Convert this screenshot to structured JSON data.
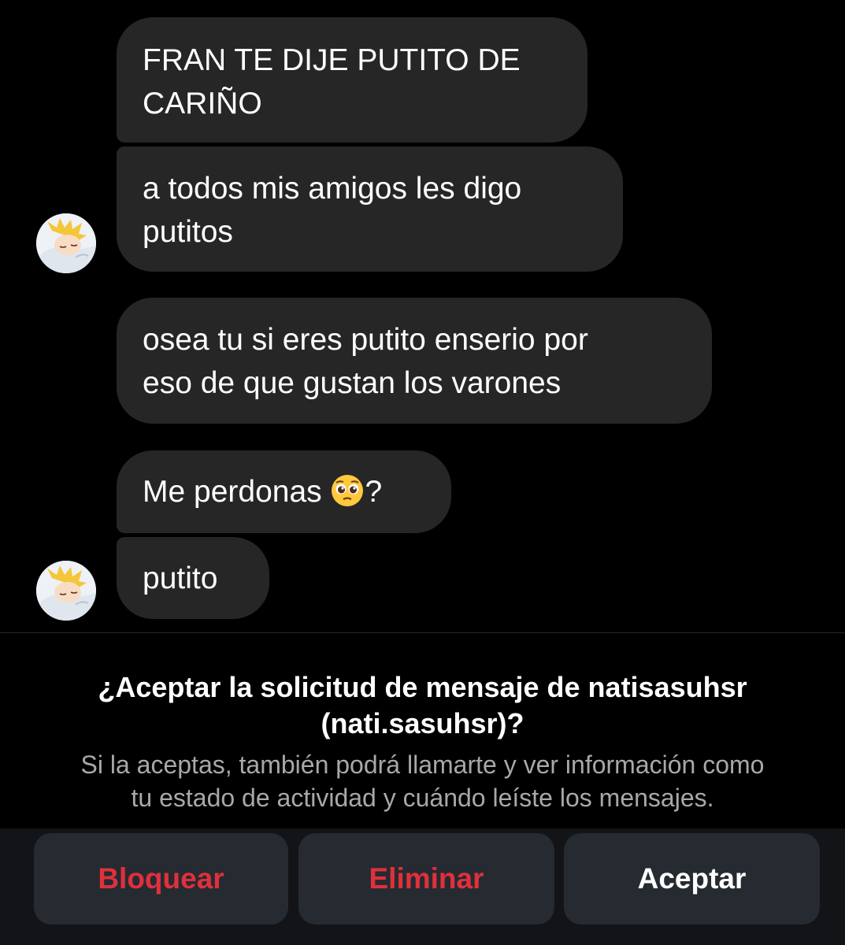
{
  "messages": [
    {
      "lines": [
        "FRAN TE DIJE PUTITO DE",
        "CARIÑO"
      ]
    },
    {
      "lines": [
        "a todos mis amigos les digo",
        "putitos"
      ]
    },
    {
      "lines": [
        "osea tu si eres putito enserio por",
        "eso de que gustan los varones"
      ]
    },
    {
      "text_before_emoji": "Me perdonas ",
      "emoji": "pleading-face",
      "text_after_emoji": "?"
    },
    {
      "lines": [
        "putito"
      ]
    }
  ],
  "request": {
    "title_line1": "¿Aceptar la solicitud de mensaje de natisasuhsr",
    "title_line2": "(nati.sasuhsr)?",
    "desc_line1": "Si la aceptas, también podrá llamarte y ver información como",
    "desc_line2": "tu estado de actividad y cuándo leíste los mensajes."
  },
  "actions": {
    "block_label": "Bloquear",
    "delete_label": "Eliminar",
    "accept_label": "Aceptar"
  },
  "colors": {
    "background": "#000000",
    "bubble": "#262626",
    "button_bg": "#262a31",
    "danger": "#e0303c",
    "secondary_text": "#a8a8a8"
  }
}
